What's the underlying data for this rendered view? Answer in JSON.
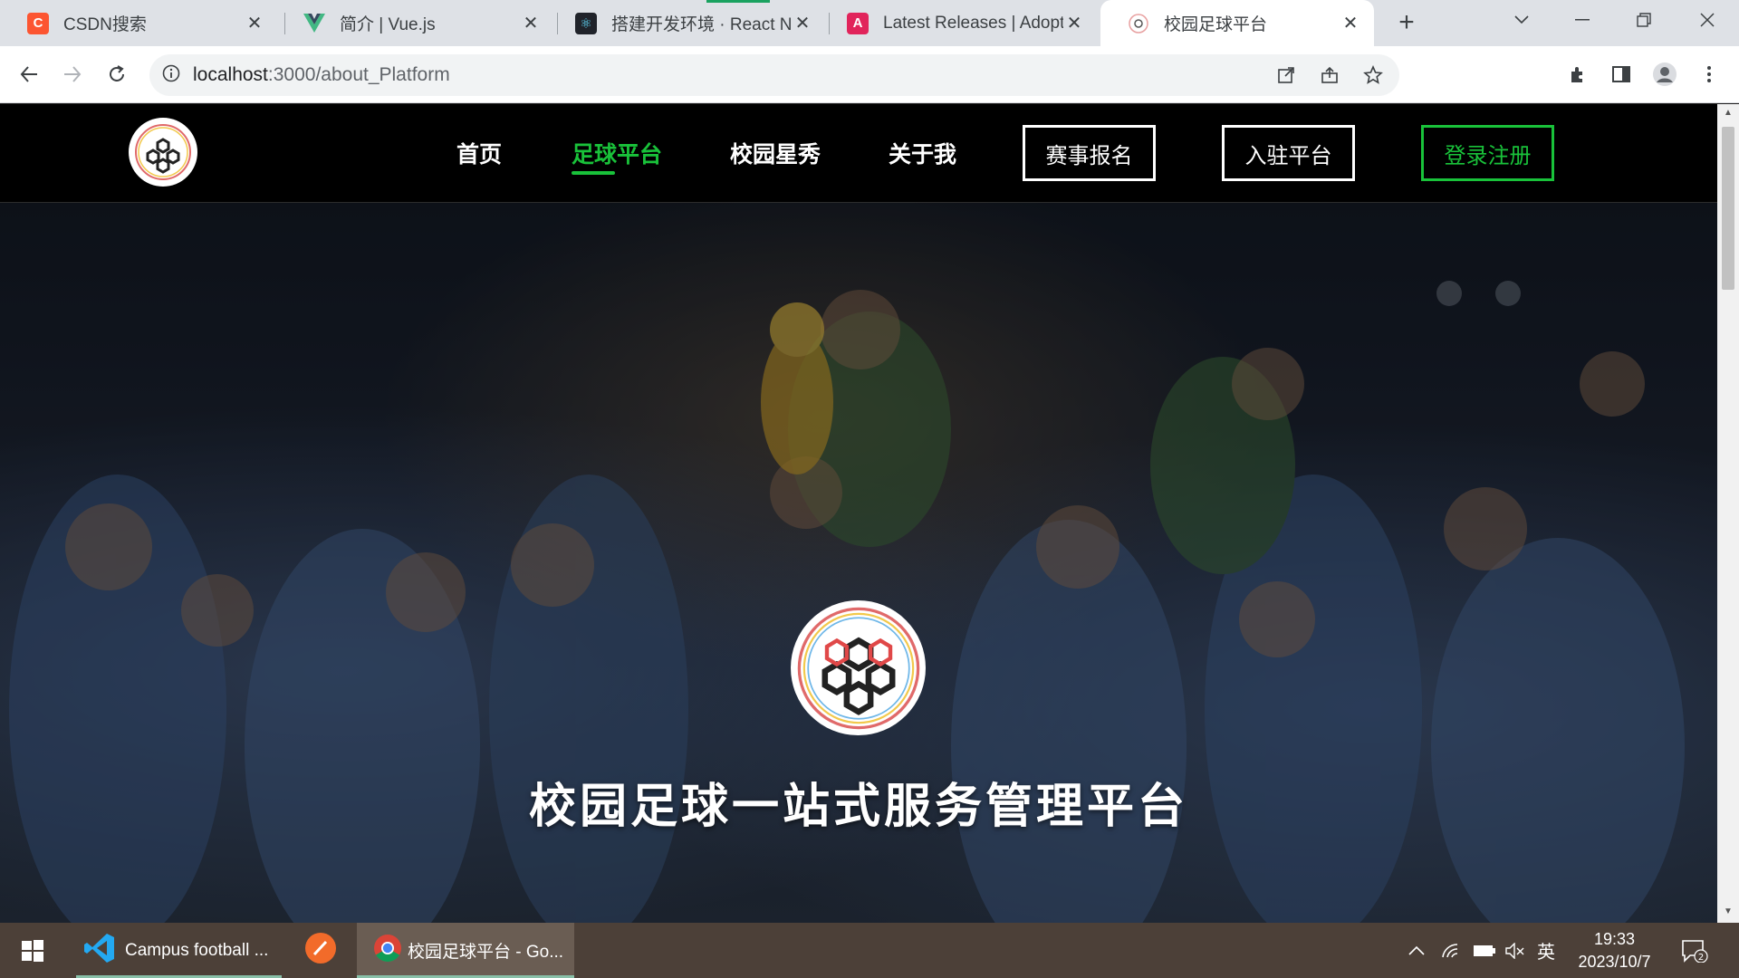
{
  "browser": {
    "tabs": [
      {
        "title": "CSDN搜索",
        "icon": "csdn-icon",
        "color": "#fc5531",
        "glyph": "C"
      },
      {
        "title": "简介 | Vue.js",
        "icon": "vue-icon",
        "color": "#42b883",
        "glyph": "V"
      },
      {
        "title": "搭建开发环境 · React Na",
        "icon": "react-icon",
        "color": "#20232a",
        "glyph": "⚛"
      },
      {
        "title": "Latest Releases | Adopt",
        "icon": "adoptium-icon",
        "color": "#e1245b",
        "glyph": "A"
      },
      {
        "title": "校园足球平台",
        "icon": "football-icon",
        "color": "#ffffff",
        "glyph": ""
      }
    ],
    "url_host": "localhost",
    "url_rest": ":3000/about_Platform"
  },
  "site": {
    "nav": {
      "home": "首页",
      "platform": "足球平台",
      "stars": "校园星秀",
      "about": "关于我",
      "match_signup": "赛事报名",
      "join_platform": "入驻平台",
      "login_register": "登录注册"
    },
    "hero_title": "校园足球一站式服务管理平台",
    "accent_color": "#19c23a"
  },
  "taskbar": {
    "vscode_label": "Campus football ...",
    "chrome_label": "校园足球平台 - Go...",
    "ime": "英",
    "time": "19:33",
    "date": "2023/10/7",
    "notifications": "2"
  }
}
